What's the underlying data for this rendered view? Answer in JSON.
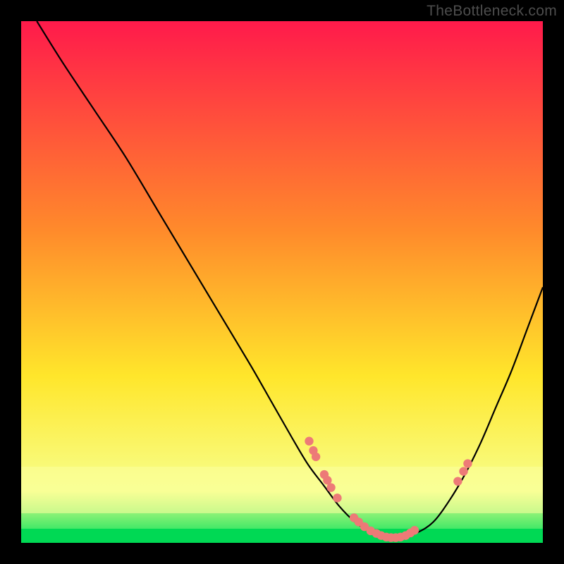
{
  "watermark": "TheBottleneck.com",
  "chart_data": {
    "type": "line",
    "title": "",
    "xlabel": "",
    "ylabel": "",
    "xlim": [
      0,
      100
    ],
    "ylim": [
      0,
      100
    ],
    "grid": false,
    "legend": false,
    "background_gradient": {
      "top": "#ff1a4b",
      "mid1": "#ff8a2b",
      "mid2": "#ffe62b",
      "band": "#f7ff8c",
      "bottom": "#00e05a"
    },
    "series": [
      {
        "name": "bottleneck-curve",
        "x": [
          3,
          8,
          14,
          20,
          26,
          32,
          38,
          44,
          48,
          52,
          55,
          58,
          61,
          64,
          67,
          70,
          73,
          76,
          79,
          82,
          85,
          88,
          91,
          94,
          97,
          100
        ],
        "y": [
          100,
          92,
          83,
          74,
          64,
          54,
          44,
          34,
          27,
          20,
          15,
          11,
          7,
          4,
          2,
          1,
          1,
          2,
          4,
          8,
          13,
          19,
          26,
          33,
          41,
          49
        ]
      }
    ],
    "marker_clusters": [
      {
        "name": "descending-cluster",
        "points": [
          {
            "x": 55.2,
            "y": 19.5
          },
          {
            "x": 56.0,
            "y": 17.7
          },
          {
            "x": 56.5,
            "y": 16.5
          },
          {
            "x": 58.1,
            "y": 13.1
          },
          {
            "x": 58.7,
            "y": 12.0
          },
          {
            "x": 59.4,
            "y": 10.6
          },
          {
            "x": 60.6,
            "y": 8.6
          }
        ]
      },
      {
        "name": "trough-cluster",
        "points": [
          {
            "x": 63.8,
            "y": 4.8
          },
          {
            "x": 64.7,
            "y": 4.0
          },
          {
            "x": 65.8,
            "y": 3.1
          },
          {
            "x": 67.0,
            "y": 2.3
          },
          {
            "x": 68.1,
            "y": 1.8
          },
          {
            "x": 69.0,
            "y": 1.4
          },
          {
            "x": 70.0,
            "y": 1.1
          },
          {
            "x": 70.9,
            "y": 1.0
          },
          {
            "x": 71.8,
            "y": 1.0
          },
          {
            "x": 72.7,
            "y": 1.1
          },
          {
            "x": 73.7,
            "y": 1.4
          },
          {
            "x": 74.6,
            "y": 1.9
          },
          {
            "x": 75.4,
            "y": 2.4
          }
        ]
      },
      {
        "name": "ascending-cluster",
        "points": [
          {
            "x": 83.7,
            "y": 11.8
          },
          {
            "x": 84.8,
            "y": 13.7
          },
          {
            "x": 85.6,
            "y": 15.2
          }
        ]
      }
    ],
    "marker_color": "#ed7a77",
    "marker_radius": 6.2,
    "line_color": "#000000",
    "line_width": 2.2
  }
}
